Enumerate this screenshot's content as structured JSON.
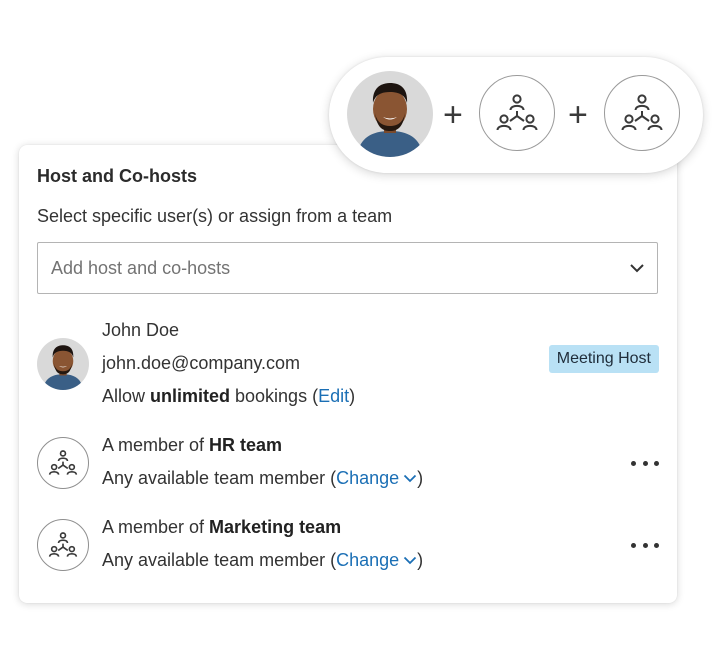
{
  "pill": {
    "plus_1": "+",
    "plus_2": "+"
  },
  "card": {
    "title": "Host and Co-hosts",
    "subtitle": "Select specific user(s) or assign from a team",
    "select": {
      "placeholder": "Add host and co-hosts",
      "icon": "chevron-down-icon"
    }
  },
  "host": {
    "name": "John Doe",
    "email": "john.doe@company.com",
    "booking_prefix": "Allow ",
    "booking_bold": "unlimited",
    "booking_suffix": " bookings (",
    "edit_label": "Edit",
    "booking_close": ")",
    "badge": "Meeting Host"
  },
  "teams": [
    {
      "prefix": "A member of ",
      "team": "HR team",
      "detail_prefix": "Any available team member (",
      "change_label": "Change",
      "detail_close": ")"
    },
    {
      "prefix": "A member of ",
      "team": "Marketing team",
      "detail_prefix": "Any available team member (",
      "change_label": "Change",
      "detail_close": ")"
    }
  ],
  "colors": {
    "link": "#1b6fb5",
    "badge_bg": "#b9e1f5",
    "avatar_bg": "#d9d9d9",
    "shirt": "#3a5f86"
  }
}
